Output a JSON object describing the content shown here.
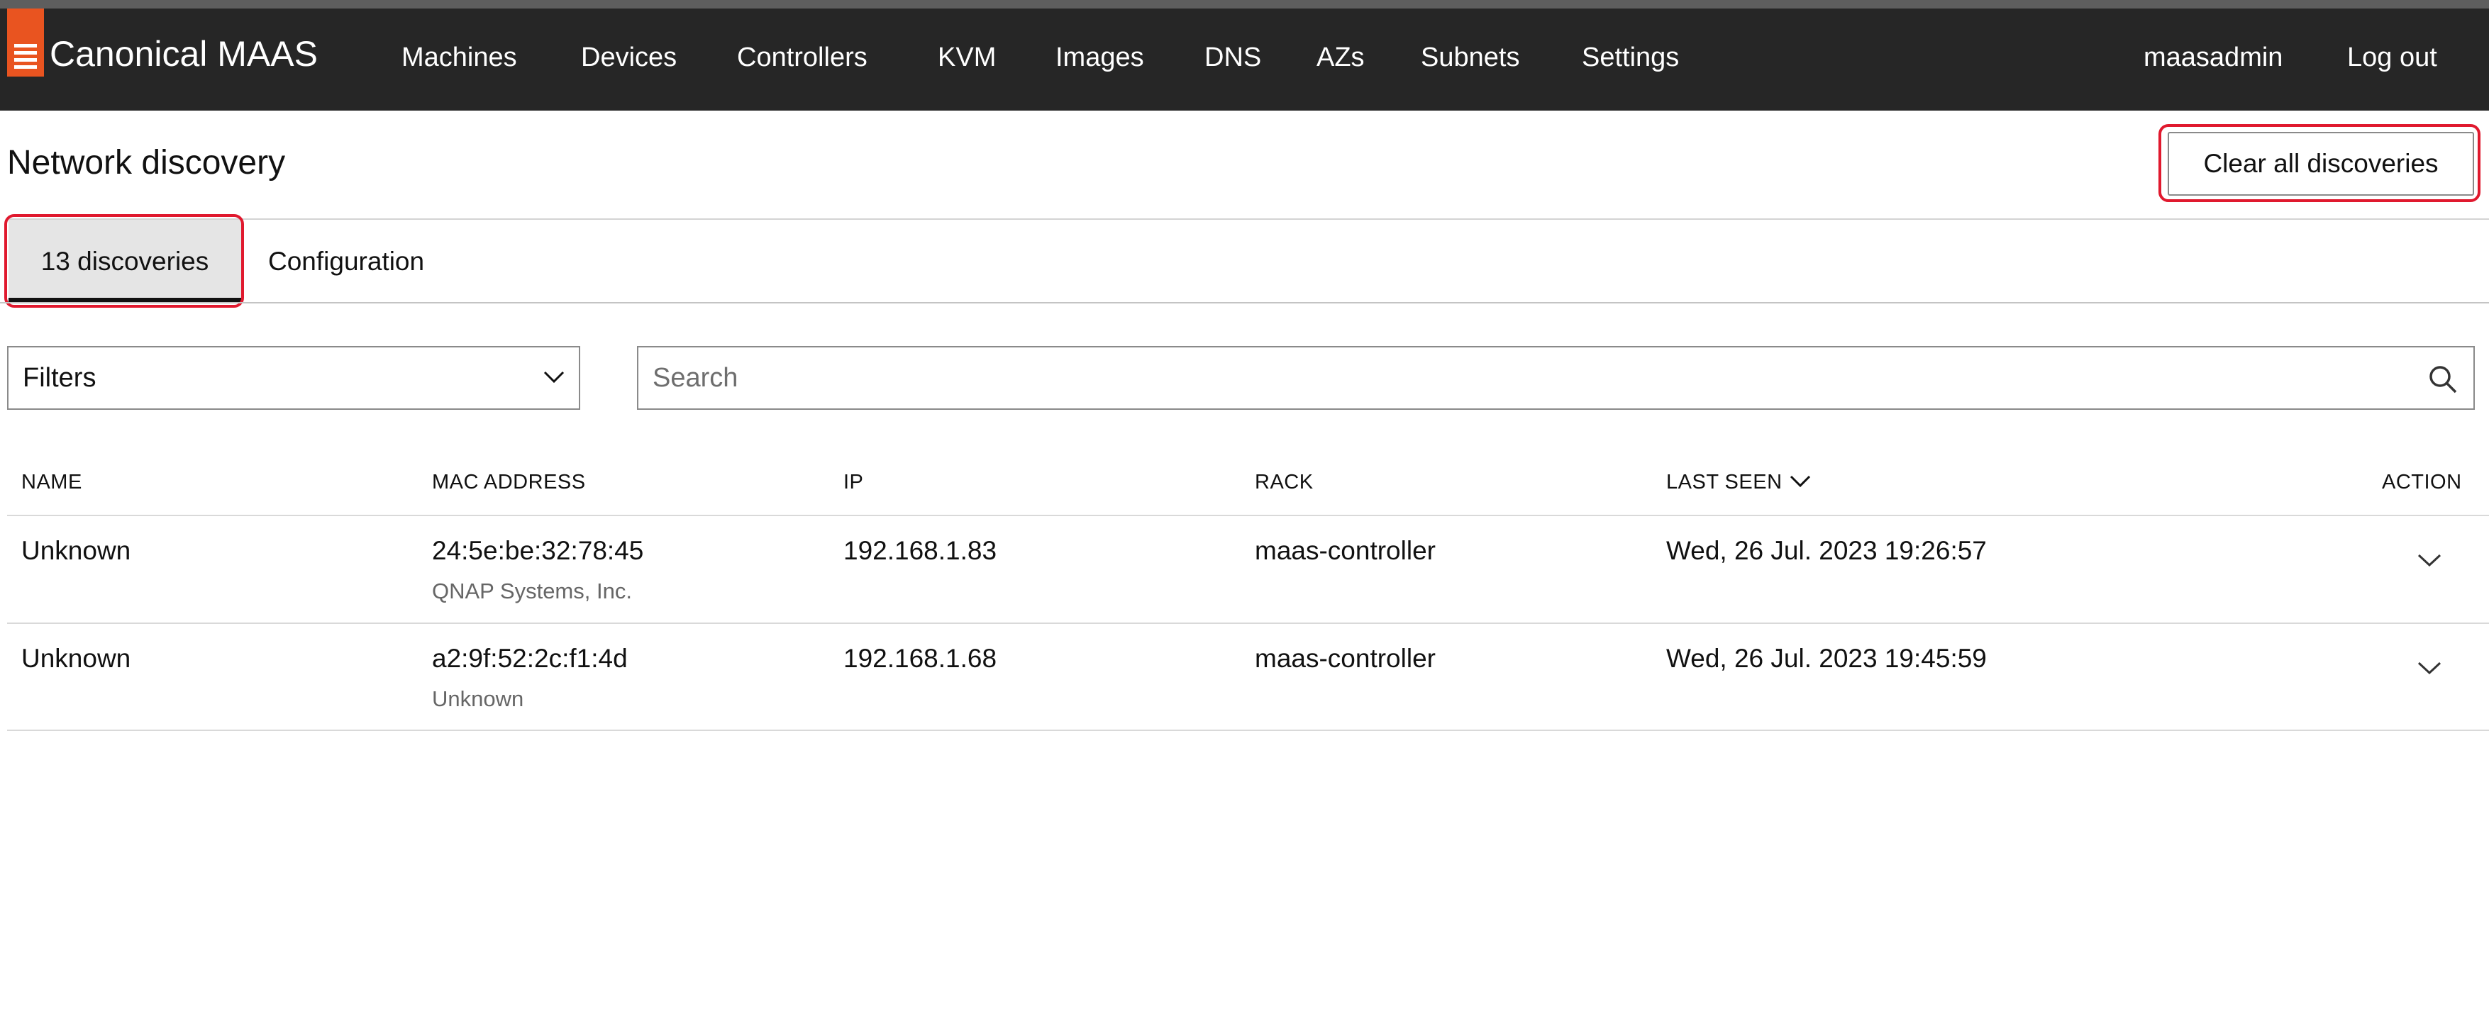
{
  "header": {
    "brand": "Canonical MAAS",
    "nav": [
      "Machines",
      "Devices",
      "Controllers",
      "KVM",
      "Images",
      "DNS",
      "AZs",
      "Subnets",
      "Settings"
    ],
    "user": "maasadmin",
    "logout": "Log out"
  },
  "page": {
    "title": "Network discovery",
    "clear_button": "Clear all discoveries"
  },
  "tabs": [
    "13 discoveries",
    "Configuration"
  ],
  "filters": {
    "label": "Filters",
    "search_placeholder": "Search"
  },
  "table": {
    "columns": [
      "NAME",
      "MAC ADDRESS",
      "IP",
      "RACK",
      "LAST SEEN",
      "ACTION"
    ],
    "rows": [
      {
        "name": "Unknown",
        "mac": "24:5e:be:32:78:45",
        "vendor": "QNAP Systems, Inc.",
        "ip": "192.168.1.83",
        "rack": "maas-controller",
        "last_seen": "Wed, 26 Jul. 2023 19:26:57"
      },
      {
        "name": "Unknown",
        "mac": "a2:9f:52:2c:f1:4d",
        "vendor": "Unknown",
        "ip": "192.168.1.68",
        "rack": "maas-controller",
        "last_seen": "Wed, 26 Jul. 2023 19:45:59"
      }
    ]
  },
  "icons": {
    "logo": "maas-logo-icon",
    "filters_dropdown": "chevron-down-icon",
    "search": "search-icon",
    "sort": "sort-descending-icon",
    "row_expand": "chevron-down-icon"
  },
  "colors": {
    "navbar": "#262626",
    "brand_accent": "#e95420",
    "highlight": "#e0192e",
    "active_tab": "#e5e5e5"
  }
}
